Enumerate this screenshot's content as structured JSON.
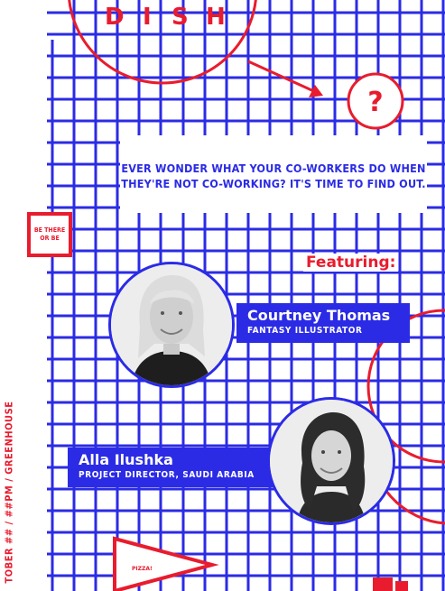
{
  "title": {
    "letters": [
      "D",
      "I",
      "S",
      "H"
    ],
    "question_mark": "?"
  },
  "tagline": {
    "line1": "EVER WONDER WHAT YOUR CO-WORKERS DO WHEN",
    "line2": "THEY'RE NOT CO-WORKING? IT'S TIME TO FIND OUT."
  },
  "badge": {
    "line1": "BE THERE",
    "line2": "OR BE"
  },
  "featuring_label": "Featuring:",
  "speakers": [
    {
      "name": "Courtney Thomas",
      "role": "FANTASY ILLUSTRATOR",
      "photo_icon": "portrait-blonde-woman"
    },
    {
      "name": "Alla Ilushka",
      "role": "PROJECT DIRECTOR, SAUDI ARABIA",
      "photo_icon": "portrait-curly-hair-woman"
    }
  ],
  "event_line": "TOBER ## / ##PM / GREENHOUSE",
  "pizza_label": "PIZZA!",
  "colors": {
    "blue": "#2b2be6",
    "red": "#e81c2e",
    "background": "#ffffff"
  }
}
